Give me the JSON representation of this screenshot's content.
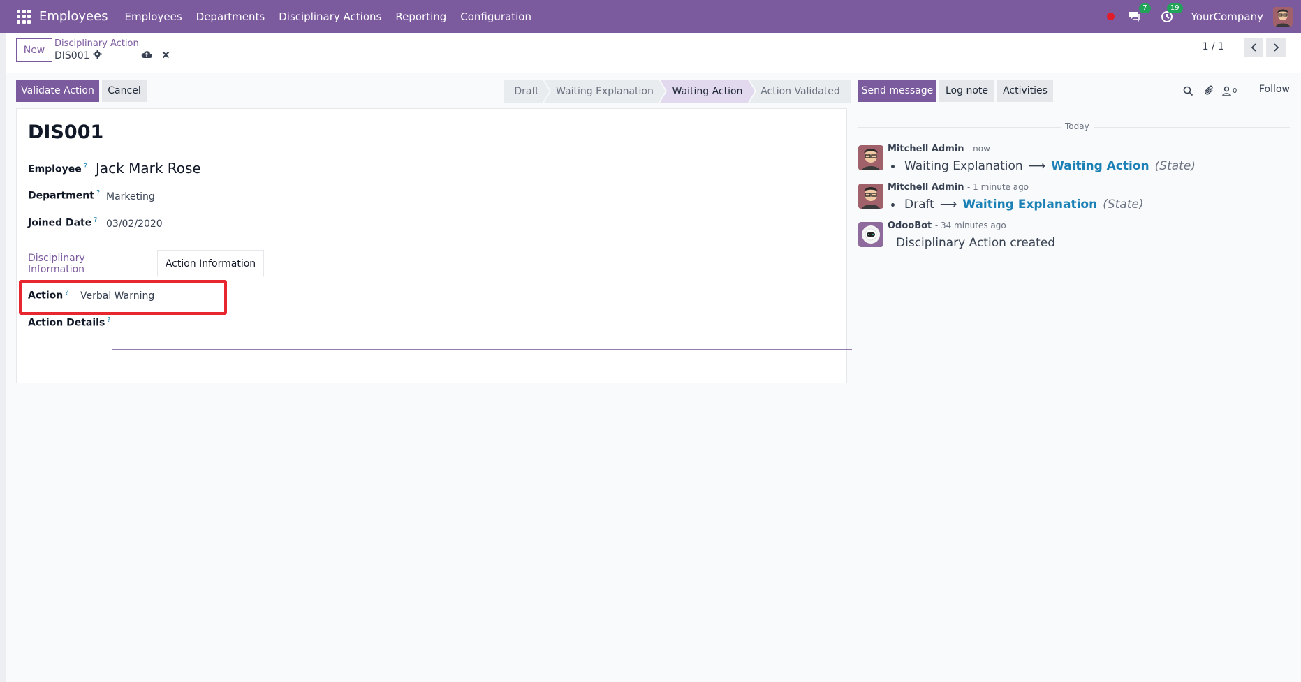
{
  "navbar": {
    "app_name": "Employees",
    "menu": [
      "Employees",
      "Departments",
      "Disciplinary Actions",
      "Reporting",
      "Configuration"
    ],
    "messages_badge": "7",
    "activities_badge": "19",
    "company": "YourCompany",
    "icons": [
      "apps-grid-icon",
      "recording-dot",
      "chat-icon",
      "clock-icon",
      "user-avatar"
    ]
  },
  "control": {
    "new_label": "New",
    "breadcrumb_parent": "Disciplinary Action",
    "breadcrumb_current": "DIS001",
    "pager": "1 / 1"
  },
  "statusbar": {
    "validate_label": "Validate Action",
    "cancel_label": "Cancel",
    "stages": [
      "Draft",
      "Waiting Explanation",
      "Waiting Action",
      "Action Validated"
    ],
    "active_stage": "Waiting Action"
  },
  "form": {
    "title": "DIS001",
    "employee_label": "Employee",
    "employee_value": "Jack Mark Rose",
    "department_label": "Department",
    "department_value": "Marketing",
    "joined_label": "Joined Date",
    "joined_value": "03/02/2020",
    "help_mark": "?",
    "tabs": [
      "Disciplinary Information",
      "Action Information"
    ],
    "active_tab": "Action Information",
    "action_label": "Action",
    "action_value": "Verbal Warning",
    "details_label": "Action Details"
  },
  "chatter": {
    "send_message": "Send message",
    "log_note": "Log note",
    "activities": "Activities",
    "followers_count": "0",
    "follow": "Follow",
    "today": "Today",
    "messages": [
      {
        "author": "Mitchell Admin",
        "time": "- now",
        "old": "Waiting Explanation",
        "new": "Waiting Action",
        "field": "(State)"
      },
      {
        "author": "Mitchell Admin",
        "time": "- 1 minute ago",
        "old": "Draft",
        "new": "Waiting Explanation",
        "field": "(State)"
      },
      {
        "author": "OdooBot",
        "time": "- 34 minutes ago",
        "text": "Disciplinary Action created"
      }
    ]
  },
  "colors": {
    "brand": "#7c5a9e",
    "link": "#1a80b6",
    "highlight": "#e8262f"
  }
}
